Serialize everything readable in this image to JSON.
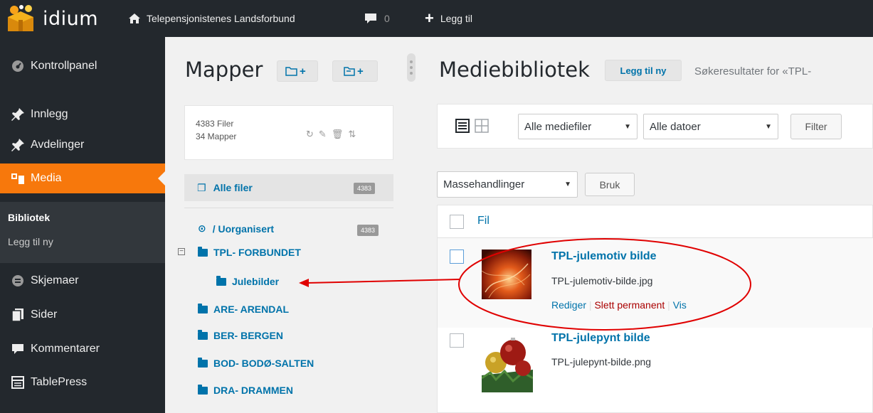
{
  "adminbar": {
    "logo": "idium",
    "site_name": "Telepensjonistenes Landsforbund",
    "comments_count": "0",
    "add_new": "Legg til"
  },
  "sidebar": {
    "items": [
      {
        "label": "Kontrollpanel",
        "icon": "dashboard-icon"
      },
      {
        "label": "Innlegg",
        "icon": "pin-icon"
      },
      {
        "label": "Avdelinger",
        "icon": "pin-icon"
      },
      {
        "label": "Media",
        "icon": "media-icon"
      },
      {
        "label": "Skjemaer",
        "icon": "forms-icon"
      },
      {
        "label": "Sider",
        "icon": "pages-icon"
      },
      {
        "label": "Kommentarer",
        "icon": "comments-icon"
      },
      {
        "label": "TablePress",
        "icon": "table-icon"
      }
    ],
    "submenu": {
      "library": "Bibliotek",
      "add_new": "Legg til ny"
    }
  },
  "folders": {
    "title": "Mapper",
    "files_count": "4383 Filer",
    "folders_count": "34 Mapper",
    "all_files": "Alle filer",
    "all_files_badge": "4383",
    "unorganized": "/ Uorganisert",
    "unorganized_badge": "4383",
    "tree": [
      "TPL- FORBUNDET",
      "Julebilder",
      "ARE- ARENDAL",
      "BER- BERGEN",
      "BOD- BODØ-SALTEN",
      "DRA- DRAMMEN"
    ]
  },
  "media": {
    "title": "Mediebibliotek",
    "add_new": "Legg til ny",
    "search_results": "Søkeresultater for «TPL-",
    "filter_type": "Alle mediefiler",
    "filter_date": "Alle datoer",
    "filter_button": "Filter",
    "bulk_actions": "Massehandlinger",
    "apply": "Bruk",
    "column_file": "Fil",
    "rows": [
      {
        "title": "TPL-julemotiv bilde",
        "filename": "TPL-julemotiv-bilde.jpg",
        "actions": {
          "edit": "Rediger",
          "delete": "Slett permanent",
          "view": "Vis"
        }
      },
      {
        "title": "TPL-julepynt bilde",
        "filename": "TPL-julepynt-bilde.png"
      }
    ]
  },
  "colors": {
    "accent": "#f7780c",
    "link": "#0073aa",
    "adminbar": "#23282d",
    "annotation": "#e00000"
  }
}
